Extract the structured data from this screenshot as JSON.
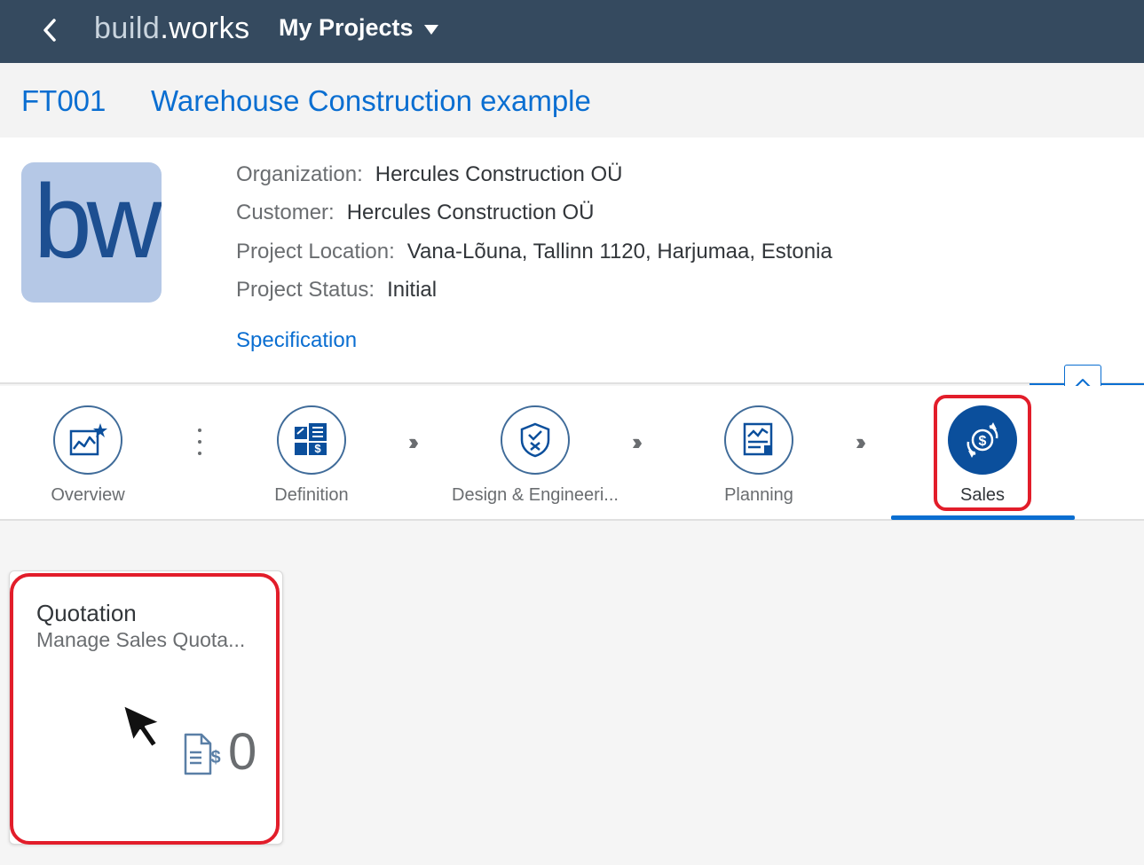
{
  "shell": {
    "back_icon": "chevron-left-icon",
    "brand_part1": "build",
    "brand_part2": ".works",
    "menu_title": "My Projects"
  },
  "project": {
    "id": "FT001",
    "name": "Warehouse Construction example",
    "attributes": [
      {
        "label": "Organization:",
        "value": "Hercules Construction OÜ"
      },
      {
        "label": "Customer:",
        "value": "Hercules Construction OÜ"
      },
      {
        "label": "Project Location:",
        "value": "Vana-Lõuna, Tallinn 1120, Harjumaa, Estonia"
      },
      {
        "label": "Project Status:",
        "value": "Initial"
      }
    ],
    "link": "Specification",
    "logo_text": "bw"
  },
  "flow": {
    "steps": [
      {
        "label": "Overview",
        "icon": "chart-star-icon"
      },
      {
        "label": "Definition",
        "icon": "checklist-dollar-icon"
      },
      {
        "label": "Design & Engineeri...",
        "icon": "shield-check-icon"
      },
      {
        "label": "Planning",
        "icon": "document-chart-icon"
      },
      {
        "label": "Sales",
        "icon": "dollar-exchange-icon"
      }
    ],
    "selected": "Sales"
  },
  "tile": {
    "title": "Quotation",
    "subtitle": "Manage Sales Quota...",
    "count": "0",
    "icon": "sales-document-icon"
  },
  "colors": {
    "shell": "#354a5f",
    "link": "#0a6ed1",
    "active_step": "#0b4f9c",
    "highlight": "#e21d2a"
  }
}
